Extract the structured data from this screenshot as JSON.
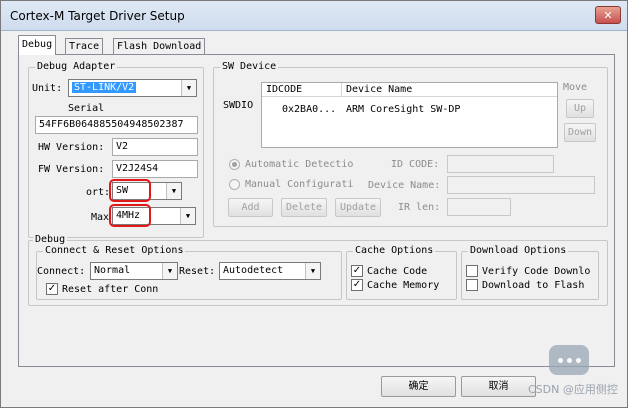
{
  "window": {
    "title": "Cortex-M Target Driver Setup",
    "close_glyph": "✕"
  },
  "tabs": [
    {
      "label": "Debug",
      "active": true
    },
    {
      "label": "Trace",
      "active": false
    },
    {
      "label": "Flash Download",
      "active": false
    }
  ],
  "debug_adapter": {
    "group_label": "Debug Adapter",
    "unit_label": "Unit:",
    "unit_value": "ST-LINK/V2",
    "serial_label": "Serial",
    "serial_value": "54FF6B064885504948502387",
    "hw_label": "HW Version:",
    "hw_value": "V2",
    "fw_label": "FW Version:",
    "fw_value": "V2J24S4",
    "port_label": "ort:",
    "port_value": "SW",
    "max_label": "Max",
    "max_value": "4MHz"
  },
  "sw_device": {
    "group_label": "SW Device",
    "swdio_label": "SWDIO",
    "col_idcode": "IDCODE",
    "col_device": "Device Name",
    "rows": [
      {
        "idcode": "0x2BA0...",
        "device": "ARM CoreSight SW-DP"
      }
    ],
    "move_label": "Move",
    "up_label": "Up",
    "down_label": "Down",
    "auto_detect": "Automatic Detectio",
    "manual_config": "Manual Configurati",
    "id_code_label": "ID CODE:",
    "device_name_label": "Device Name:",
    "ir_len_label": "IR len:",
    "add_label": "Add",
    "delete_label": "Delete",
    "update_label": "Update"
  },
  "debug": {
    "group_label": "Debug",
    "connect_reset": {
      "group_label": "Connect & Reset Options",
      "connect_label": "Connect:",
      "connect_value": "Normal",
      "reset_label": "Reset:",
      "reset_value": "Autodetect",
      "reset_after_conn_label": "Reset after Conn",
      "reset_after_conn_checked": true
    },
    "cache": {
      "group_label": "Cache Options",
      "cache_code_label": "Cache Code",
      "cache_code_checked": true,
      "cache_memory_label": "Cache Memory",
      "cache_memory_checked": true
    },
    "download": {
      "group_label": "Download Options",
      "verify_label": "Verify Code Downlo",
      "verify_checked": false,
      "download_flash_label": "Download to Flash",
      "download_flash_checked": false
    }
  },
  "footer": {
    "ok_label": "确定",
    "cancel_label": "取消"
  },
  "watermark": {
    "text": "CSDN @应用侧控"
  },
  "icons": {
    "dropdown": "chevron-down-icon",
    "check": "✓",
    "dropdown_glyph": "▼"
  }
}
